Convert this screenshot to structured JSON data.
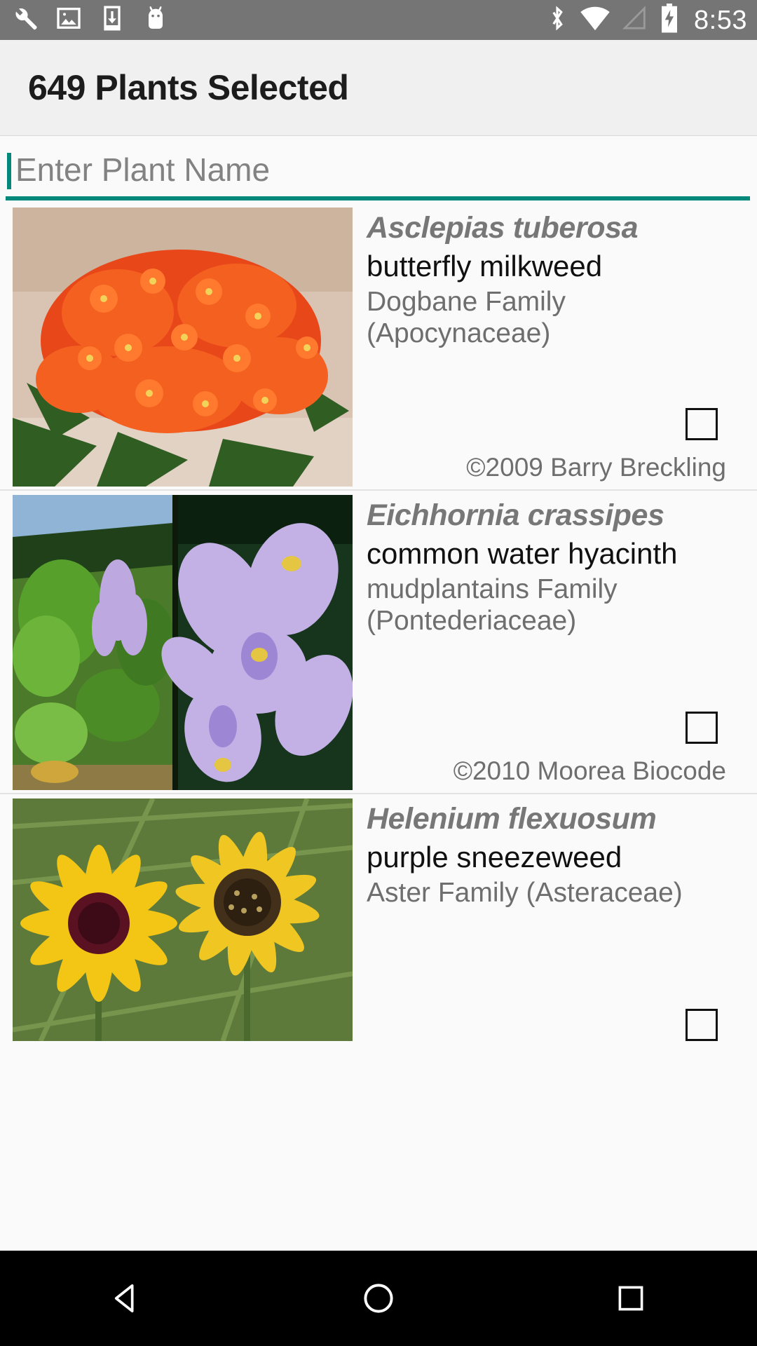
{
  "statusbar": {
    "left_icons": [
      {
        "name": "wrench-icon",
        "label": "wrench"
      },
      {
        "name": "image-icon",
        "label": "screenshot"
      },
      {
        "name": "download-icon",
        "label": "download"
      },
      {
        "name": "android-icon",
        "label": "android"
      }
    ],
    "right_icons": [
      {
        "name": "bluetooth-icon",
        "label": "bluetooth"
      },
      {
        "name": "wifi-icon",
        "label": "wifi-full"
      },
      {
        "name": "cellular-signal-icon",
        "label": "signal-none"
      },
      {
        "name": "battery-charging-icon",
        "label": "battery-charging"
      }
    ],
    "clock": "8:53"
  },
  "appbar": {
    "title": "649 Plants Selected"
  },
  "search": {
    "placeholder": "Enter Plant Name",
    "value": "",
    "accent_color": "#00897b"
  },
  "list": {
    "rows": [
      {
        "scientific_name": "Asclepias tuberosa",
        "common_name": "butterfly milkweed",
        "family": "Dogbane Family (Apocynaceae)",
        "credit": "©2009 Barry Breckling",
        "checked": false,
        "thumb_kind": "orange-milkweed"
      },
      {
        "scientific_name": "Eichhornia crassipes",
        "common_name": "common water hyacinth",
        "family": "mudplantains Family (Pontederiaceae)",
        "credit": "©2010 Moorea Biocode",
        "checked": false,
        "thumb_kind": "purple-hyacinth"
      },
      {
        "scientific_name": "Helenium flexuosum",
        "common_name": "purple sneezeweed",
        "family": "Aster Family (Asteraceae)",
        "credit": "",
        "checked": false,
        "thumb_kind": "yellow-sneezeweed"
      }
    ]
  },
  "navbar": {
    "buttons": [
      {
        "name": "back-button",
        "label": "back"
      },
      {
        "name": "home-button",
        "label": "home"
      },
      {
        "name": "recents-button",
        "label": "recents"
      }
    ]
  }
}
